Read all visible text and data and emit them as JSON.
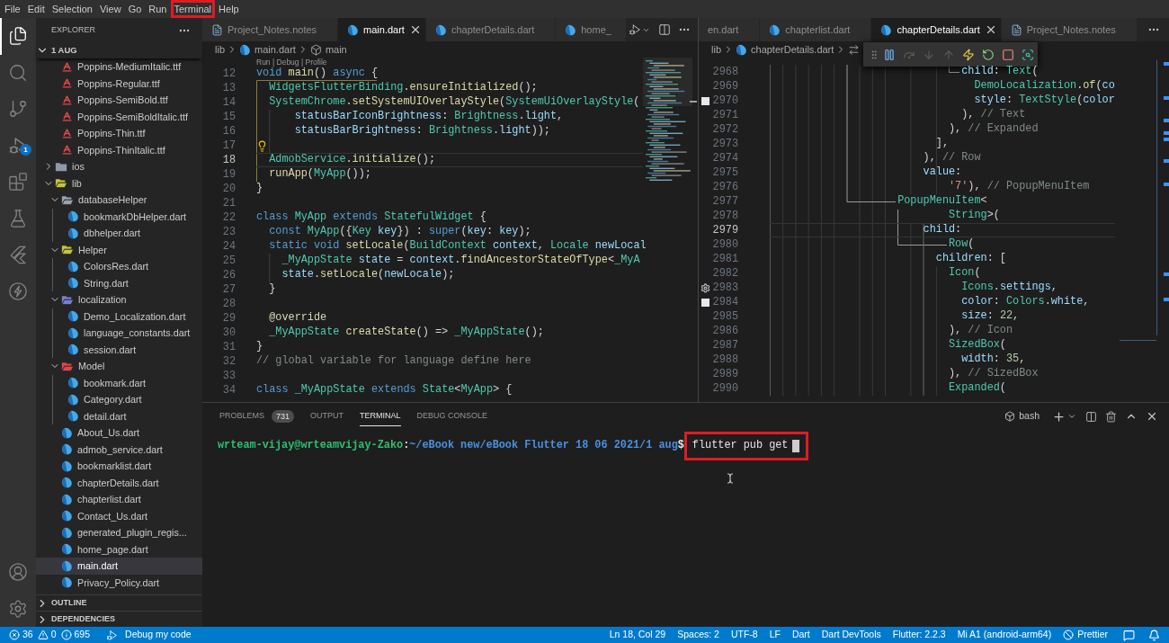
{
  "menu_bar": [
    {
      "label": "File",
      "highlighted": false
    },
    {
      "label": "Edit",
      "highlighted": false
    },
    {
      "label": "Selection",
      "highlighted": false
    },
    {
      "label": "View",
      "highlighted": false
    },
    {
      "label": "Go",
      "highlighted": false
    },
    {
      "label": "Run",
      "highlighted": false
    },
    {
      "label": "Terminal",
      "highlighted": true
    },
    {
      "label": "Help",
      "highlighted": false
    }
  ],
  "activity_bar": {
    "top": [
      {
        "kind": "explorer",
        "selected": true
      },
      {
        "kind": "search",
        "selected": false
      },
      {
        "kind": "source_control",
        "selected": false
      },
      {
        "kind": "run_debug",
        "selected": false,
        "badge": "1"
      },
      {
        "kind": "extensions",
        "selected": false
      },
      {
        "kind": "testing",
        "selected": false
      },
      {
        "kind": "flutter",
        "selected": false
      },
      {
        "kind": "lightning",
        "selected": false
      }
    ],
    "bottom": [
      {
        "kind": "accounts"
      },
      {
        "kind": "manage"
      }
    ]
  },
  "sidebar": {
    "title": "EXPLORER",
    "section": {
      "label": "1 AUG",
      "expanded": true
    },
    "tree": [
      {
        "children": [
          {
            "label": "Poppins-MediumItalic.ttf",
            "kind": "font",
            "selected": false
          },
          {
            "label": "Poppins-Regular.ttf",
            "kind": "font",
            "selected": false
          },
          {
            "label": "Poppins-SemiBold.ttf",
            "kind": "font",
            "selected": false
          },
          {
            "label": "Poppins-SemiBoldItalic.ttf",
            "kind": "font",
            "selected": false
          },
          {
            "label": "Poppins-Thin.ttf",
            "kind": "font",
            "selected": false
          },
          {
            "label": "Poppins-ThinItalic.ttf",
            "kind": "font",
            "selected": false
          }
        ]
      },
      {
        "label": "ios",
        "kind": "folder",
        "color": "#8d99a6",
        "expanded": false,
        "selected": false
      },
      {
        "label": "lib",
        "kind": "folder",
        "color": "#c5c53a",
        "expanded": true,
        "selected": false,
        "children": [
          {
            "label": "databaseHelper",
            "kind": "folder",
            "color": "#98a4b0",
            "expanded": true,
            "selected": false,
            "children": [
              {
                "label": "bookmarkDbHelper.dart",
                "kind": "dart",
                "selected": false
              },
              {
                "label": "dbhelper.dart",
                "kind": "dart",
                "selected": false
              }
            ]
          },
          {
            "label": "Helper",
            "kind": "folder",
            "color": "#c5c53a",
            "expanded": true,
            "selected": false,
            "children": [
              {
                "label": "ColorsRes.dart",
                "kind": "dart",
                "selected": false
              },
              {
                "label": "String.dart",
                "kind": "dart",
                "selected": false
              }
            ]
          },
          {
            "label": "localization",
            "kind": "folder",
            "color": "#7b7fd4",
            "expanded": true,
            "selected": false,
            "children": [
              {
                "label": "Demo_Localization.dart",
                "kind": "dart",
                "selected": false
              },
              {
                "label": "language_constants.dart",
                "kind": "dart",
                "selected": false
              },
              {
                "label": "session.dart",
                "kind": "dart",
                "selected": false
              }
            ]
          },
          {
            "label": "Model",
            "kind": "folder",
            "color": "#e0474c",
            "expanded": true,
            "selected": false,
            "children": [
              {
                "label": "bookmark.dart",
                "kind": "dart",
                "selected": false
              },
              {
                "label": "Category.dart",
                "kind": "dart",
                "selected": false
              },
              {
                "label": "detail.dart",
                "kind": "dart",
                "selected": false
              }
            ]
          },
          {
            "label": "About_Us.dart",
            "kind": "dart",
            "selected": false
          },
          {
            "label": "admob_service.dart",
            "kind": "dart",
            "selected": false
          },
          {
            "label": "bookmarklist.dart",
            "kind": "dart",
            "selected": false
          },
          {
            "label": "chapterDetails.dart",
            "kind": "dart",
            "selected": false
          },
          {
            "label": "chapterlist.dart",
            "kind": "dart",
            "selected": false
          },
          {
            "label": "Contact_Us.dart",
            "kind": "dart",
            "selected": false
          },
          {
            "label": "generated_plugin_regis...",
            "kind": "dart",
            "selected": false
          },
          {
            "label": "home_page.dart",
            "kind": "dart",
            "selected": false
          },
          {
            "label": "main.dart",
            "kind": "dart",
            "selected": true
          },
          {
            "label": "Privacy_Policy.dart",
            "kind": "dart",
            "selected": false
          }
        ]
      }
    ],
    "footer_sections": [
      {
        "label": "OUTLINE",
        "expanded": false
      },
      {
        "label": "DEPENDENCIES",
        "expanded": false
      }
    ]
  },
  "editors": {
    "left": {
      "tabs": [
        {
          "label": "Project_Notes.notes",
          "kind": "notes",
          "selected": false
        },
        {
          "label": "main.dart",
          "kind": "dart",
          "selected": true
        },
        {
          "label": "chapterDetails.dart",
          "kind": "dart",
          "selected": false
        },
        {
          "label": "home_",
          "kind": "dart",
          "selected": false
        }
      ],
      "breadcrumb": [
        {
          "text": "lib",
          "kind": "folder"
        },
        {
          "text": "main.dart",
          "kind": "dart"
        },
        {
          "text": "main",
          "kind": "symbol"
        }
      ],
      "codelens": "Run | Debug | Profile",
      "lines": [
        {
          "number": "12",
          "current": false,
          "tokens": [
            {
              "text": "void ",
              "kind": "kw"
            },
            {
              "text": "main",
              "kind": "fn"
            },
            {
              "text": "() ",
              "kind": "punct"
            },
            {
              "text": "async",
              "kind": "kw"
            },
            {
              "text": " {",
              "kind": "punct"
            }
          ]
        },
        {
          "number": "13",
          "current": false,
          "tokens": [
            {
              "text": "  WidgetsFlutterBinding",
              "kind": "type"
            },
            {
              "text": ".",
              "kind": "punct"
            },
            {
              "text": "ensureInitialized",
              "kind": "fn"
            },
            {
              "text": "();",
              "kind": "punct"
            }
          ]
        },
        {
          "number": "14",
          "current": false,
          "tokens": [
            {
              "text": "  SystemChrome",
              "kind": "type"
            },
            {
              "text": ".",
              "kind": "punct"
            },
            {
              "text": "setSystemUIOverlayStyle",
              "kind": "fn"
            },
            {
              "text": "(",
              "kind": "punct"
            },
            {
              "text": "SystemUiOverlayStyle",
              "kind": "type"
            },
            {
              "text": "(",
              "kind": "punct"
            }
          ]
        },
        {
          "number": "15",
          "current": false,
          "tokens": [
            {
              "text": "      statusBarIconBrightness",
              "kind": "var"
            },
            {
              "text": ": ",
              "kind": "punct"
            },
            {
              "text": "Brightness",
              "kind": "type"
            },
            {
              "text": ".",
              "kind": "punct"
            },
            {
              "text": "light",
              "kind": "var"
            },
            {
              "text": ",",
              "kind": "punct"
            }
          ]
        },
        {
          "number": "16",
          "current": false,
          "tokens": [
            {
              "text": "      statusBarBrightness",
              "kind": "var"
            },
            {
              "text": ": ",
              "kind": "punct"
            },
            {
              "text": "Brightness",
              "kind": "type"
            },
            {
              "text": ".",
              "kind": "punct"
            },
            {
              "text": "light",
              "kind": "var"
            },
            {
              "text": "));",
              "kind": "punct"
            }
          ]
        },
        {
          "number": "17",
          "current": false,
          "marker": {
            "kind": "lightbulb"
          }
        },
        {
          "number": "18",
          "current": true,
          "tokens": [
            {
              "text": "  AdmobService",
              "kind": "type"
            },
            {
              "text": ".",
              "kind": "punct"
            },
            {
              "text": "initialize",
              "kind": "fn"
            },
            {
              "text": "();",
              "kind": "punct"
            }
          ]
        },
        {
          "number": "19",
          "current": false,
          "tokens": [
            {
              "text": "  runApp",
              "kind": "fn"
            },
            {
              "text": "(",
              "kind": "punct"
            },
            {
              "text": "MyApp",
              "kind": "type"
            },
            {
              "text": "());",
              "kind": "punct"
            }
          ]
        },
        {
          "number": "20",
          "current": false,
          "tokens": [
            {
              "text": "}",
              "kind": "punct"
            }
          ]
        },
        {
          "number": "21",
          "current": false
        },
        {
          "number": "22",
          "current": false,
          "tokens": [
            {
              "text": "class ",
              "kind": "kw"
            },
            {
              "text": "MyApp ",
              "kind": "type"
            },
            {
              "text": "extends ",
              "kind": "kw"
            },
            {
              "text": "StatefulWidget",
              "kind": "type"
            },
            {
              "text": " {",
              "kind": "punct"
            }
          ]
        },
        {
          "number": "23",
          "current": false,
          "tokens": [
            {
              "text": "  const ",
              "kind": "kw"
            },
            {
              "text": "MyApp",
              "kind": "type"
            },
            {
              "text": "({",
              "kind": "punct"
            },
            {
              "text": "Key ",
              "kind": "type"
            },
            {
              "text": "key",
              "kind": "var"
            },
            {
              "text": "}) : ",
              "kind": "punct"
            },
            {
              "text": "super",
              "kind": "kw"
            },
            {
              "text": "(",
              "kind": "punct"
            },
            {
              "text": "key",
              "kind": "var"
            },
            {
              "text": ": ",
              "kind": "punct"
            },
            {
              "text": "key",
              "kind": "var"
            },
            {
              "text": ");",
              "kind": "punct"
            }
          ]
        },
        {
          "number": "24",
          "current": false,
          "tokens": [
            {
              "text": "  static void ",
              "kind": "kw"
            },
            {
              "text": "setLocale",
              "kind": "fn"
            },
            {
              "text": "(",
              "kind": "punct"
            },
            {
              "text": "BuildContext ",
              "kind": "type"
            },
            {
              "text": "context",
              "kind": "var"
            },
            {
              "text": ", ",
              "kind": "punct"
            },
            {
              "text": "Locale ",
              "kind": "type"
            },
            {
              "text": "newLocal",
              "kind": "var"
            }
          ]
        },
        {
          "number": "25",
          "current": false,
          "tokens": [
            {
              "text": "    _MyAppState ",
              "kind": "type"
            },
            {
              "text": "state",
              "kind": "var"
            },
            {
              "text": " = ",
              "kind": "punct"
            },
            {
              "text": "context",
              "kind": "var"
            },
            {
              "text": ".",
              "kind": "punct"
            },
            {
              "text": "findAncestorStateOfType",
              "kind": "fn"
            },
            {
              "text": "<",
              "kind": "punct"
            },
            {
              "text": "_MyA",
              "kind": "type"
            }
          ]
        },
        {
          "number": "26",
          "current": false,
          "tokens": [
            {
              "text": "    state",
              "kind": "var"
            },
            {
              "text": ".",
              "kind": "punct"
            },
            {
              "text": "setLocale",
              "kind": "fn"
            },
            {
              "text": "(",
              "kind": "punct"
            },
            {
              "text": "newLocale",
              "kind": "var"
            },
            {
              "text": ");",
              "kind": "punct"
            }
          ]
        },
        {
          "number": "27",
          "current": false,
          "tokens": [
            {
              "text": "  }",
              "kind": "punct"
            }
          ]
        },
        {
          "number": "28",
          "current": false
        },
        {
          "number": "29",
          "current": false,
          "tokens": [
            {
              "text": "  @override",
              "kind": "annotation"
            }
          ]
        },
        {
          "number": "30",
          "current": false,
          "tokens": [
            {
              "text": "  _MyAppState ",
              "kind": "type"
            },
            {
              "text": "createState",
              "kind": "fn"
            },
            {
              "text": "() => ",
              "kind": "punct"
            },
            {
              "text": "_MyAppState",
              "kind": "type"
            },
            {
              "text": "();",
              "kind": "punct"
            }
          ]
        },
        {
          "number": "31",
          "current": false,
          "tokens": [
            {
              "text": "}",
              "kind": "punct"
            }
          ]
        },
        {
          "number": "32",
          "current": false,
          "tokens": [
            {
              "text": "// global variable for language define here",
              "kind": "comment"
            }
          ]
        },
        {
          "number": "33",
          "current": false
        },
        {
          "number": "34",
          "current": false,
          "tokens": [
            {
              "text": "class ",
              "kind": "kw"
            },
            {
              "text": "_MyAppState ",
              "kind": "type"
            },
            {
              "text": "extends ",
              "kind": "kw"
            },
            {
              "text": "State",
              "kind": "type"
            },
            {
              "text": "<",
              "kind": "punct"
            },
            {
              "text": "MyApp",
              "kind": "type"
            },
            {
              "text": "> {",
              "kind": "punct"
            }
          ]
        }
      ]
    },
    "right": {
      "tabs": [
        {
          "label": "en.dart",
          "kind": "plain",
          "selected": false
        },
        {
          "label": "chapterlist.dart",
          "kind": "dart",
          "selected": false
        },
        {
          "label": "chapterDetails.dart",
          "kind": "dart",
          "selected": true
        },
        {
          "label": "Project_Notes.notes",
          "kind": "notes",
          "selected": false
        }
      ],
      "breadcrumb": [
        {
          "text": "lib",
          "kind": "folder"
        },
        {
          "text": "chapterDetails.dart",
          "kind": "dart"
        },
        {
          "kind": "method"
        }
      ],
      "debug_toolbar": [
        {
          "kind": "pause",
          "disabled": false
        },
        {
          "kind": "step_over",
          "disabled": true
        },
        {
          "kind": "step_into",
          "disabled": true
        },
        {
          "kind": "step_out",
          "disabled": true
        },
        {
          "kind": "hot_reload",
          "disabled": false
        },
        {
          "kind": "restart",
          "disabled": false
        },
        {
          "kind": "stop",
          "disabled": false
        },
        {
          "kind": "devtools",
          "disabled": false
        }
      ],
      "lines": [
        {
          "number": "2968",
          "current": false,
          "tokens": [
            {
              "text": "                              child",
              "kind": "var"
            },
            {
              "text": ": ",
              "kind": "punct"
            },
            {
              "text": "Text",
              "kind": "type"
            },
            {
              "text": "(",
              "kind": "punct"
            }
          ]
        },
        {
          "number": "2969",
          "current": false,
          "tokens": [
            {
              "text": "                                DemoLocalization",
              "kind": "type"
            },
            {
              "text": ".",
              "kind": "punct"
            },
            {
              "text": "of",
              "kind": "fn"
            },
            {
              "text": "(",
              "kind": "punct"
            },
            {
              "text": "co",
              "kind": "var"
            }
          ]
        },
        {
          "number": "2970",
          "current": false,
          "marker": {
            "kind": "swatch"
          },
          "tokens": [
            {
              "text": "                                style",
              "kind": "var"
            },
            {
              "text": ": ",
              "kind": "punct"
            },
            {
              "text": "TextStyle",
              "kind": "type"
            },
            {
              "text": "(",
              "kind": "punct"
            },
            {
              "text": "color",
              "kind": "var"
            }
          ]
        },
        {
          "number": "2971",
          "current": false,
          "tokens": [
            {
              "text": "                              ), ",
              "kind": "punct"
            },
            {
              "text": "// Text",
              "kind": "comment"
            }
          ]
        },
        {
          "number": "2972",
          "current": false,
          "tokens": [
            {
              "text": "                            ), ",
              "kind": "punct"
            },
            {
              "text": "// Expanded",
              "kind": "comment"
            }
          ]
        },
        {
          "number": "2973",
          "current": false,
          "tokens": [
            {
              "text": "                          ],",
              "kind": "punct"
            }
          ]
        },
        {
          "number": "2974",
          "current": false,
          "tokens": [
            {
              "text": "                        ), ",
              "kind": "punct"
            },
            {
              "text": "// Row",
              "kind": "comment"
            }
          ]
        },
        {
          "number": "2975",
          "current": false,
          "tokens": [
            {
              "text": "                        value",
              "kind": "var"
            },
            {
              "text": ":",
              "kind": "punct"
            }
          ]
        },
        {
          "number": "2976",
          "current": false,
          "tokens": [
            {
              "text": "                            '7'",
              "kind": "string"
            },
            {
              "text": "), ",
              "kind": "punct"
            },
            {
              "text": "// PopupMenuItem",
              "kind": "comment"
            }
          ]
        },
        {
          "number": "2977",
          "current": false,
          "tokens": [
            {
              "text": "                    PopupMenuItem",
              "kind": "type"
            },
            {
              "text": "<",
              "kind": "punct"
            }
          ]
        },
        {
          "number": "2978",
          "current": false,
          "tokens": [
            {
              "text": "                            String",
              "kind": "type"
            },
            {
              "text": ">(",
              "kind": "punct"
            }
          ]
        },
        {
          "number": "2979",
          "current": true,
          "tokens": [
            {
              "text": "                        child",
              "kind": "var"
            },
            {
              "text": ":",
              "kind": "punct"
            }
          ]
        },
        {
          "number": "2980",
          "current": false,
          "tokens": [
            {
              "text": "                            Row",
              "kind": "type"
            },
            {
              "text": "(",
              "kind": "punct"
            }
          ]
        },
        {
          "number": "2981",
          "current": false,
          "tokens": [
            {
              "text": "                          children",
              "kind": "var"
            },
            {
              "text": ": [",
              "kind": "punct"
            }
          ]
        },
        {
          "number": "2982",
          "current": false,
          "tokens": [
            {
              "text": "                            Icon",
              "kind": "type"
            },
            {
              "text": "(",
              "kind": "punct"
            }
          ]
        },
        {
          "number": "2983",
          "current": false,
          "marker": {
            "kind": "gear"
          },
          "tokens": [
            {
              "text": "                              Icons",
              "kind": "type"
            },
            {
              "text": ".",
              "kind": "punct"
            },
            {
              "text": "settings",
              "kind": "var"
            },
            {
              "text": ",",
              "kind": "punct"
            }
          ]
        },
        {
          "number": "2984",
          "current": false,
          "marker": {
            "kind": "swatch"
          },
          "tokens": [
            {
              "text": "                              color",
              "kind": "var"
            },
            {
              "text": ": ",
              "kind": "punct"
            },
            {
              "text": "Colors",
              "kind": "type"
            },
            {
              "text": ".",
              "kind": "punct"
            },
            {
              "text": "white",
              "kind": "var"
            },
            {
              "text": ",",
              "kind": "punct"
            }
          ]
        },
        {
          "number": "2985",
          "current": false,
          "tokens": [
            {
              "text": "                              size",
              "kind": "var"
            },
            {
              "text": ": ",
              "kind": "punct"
            },
            {
              "text": "22",
              "kind": "num"
            },
            {
              "text": ",",
              "kind": "punct"
            }
          ]
        },
        {
          "number": "2986",
          "current": false,
          "tokens": [
            {
              "text": "                            ), ",
              "kind": "punct"
            },
            {
              "text": "// Icon",
              "kind": "comment"
            }
          ]
        },
        {
          "number": "2987",
          "current": false,
          "tokens": [
            {
              "text": "                            SizedBox",
              "kind": "type"
            },
            {
              "text": "(",
              "kind": "punct"
            }
          ]
        },
        {
          "number": "2988",
          "current": false,
          "tokens": [
            {
              "text": "                              width",
              "kind": "var"
            },
            {
              "text": ": ",
              "kind": "punct"
            },
            {
              "text": "35",
              "kind": "num"
            },
            {
              "text": ",",
              "kind": "punct"
            }
          ]
        },
        {
          "number": "2989",
          "current": false,
          "tokens": [
            {
              "text": "                            ), ",
              "kind": "punct"
            },
            {
              "text": "// SizedBox",
              "kind": "comment"
            }
          ]
        },
        {
          "number": "2990",
          "current": false,
          "tokens": [
            {
              "text": "                            Expanded",
              "kind": "type"
            },
            {
              "text": "(",
              "kind": "punct"
            }
          ]
        }
      ]
    }
  },
  "panel": {
    "tabs": [
      {
        "label": "PROBLEMS",
        "badge": "731",
        "selected": false
      },
      {
        "label": "OUTPUT",
        "selected": false
      },
      {
        "label": "TERMINAL",
        "selected": true
      },
      {
        "label": "DEBUG CONSOLE",
        "selected": false
      }
    ],
    "terminal_name": "bash"
  },
  "terminal": {
    "user_host": "wrteam-vijay@wrteamvijay-Zako",
    "separator": ":",
    "path": "~/eBook new/eBook Flutter 18 06 2021/1 aug",
    "prompt_symbol": "$",
    "command": "flutter pub get",
    "highlighted": true
  },
  "status_bar": {
    "errors": "36",
    "warnings": "0",
    "infos": "695",
    "debug_target": "Debug my code",
    "items": [
      {
        "kind": "text",
        "text": "Ln 18, Col 29"
      },
      {
        "kind": "text",
        "text": "Spaces: 2"
      },
      {
        "kind": "text",
        "text": "UTF-8"
      },
      {
        "kind": "text",
        "text": "LF"
      },
      {
        "kind": "text",
        "text": "Dart"
      },
      {
        "kind": "text",
        "text": "Dart DevTools"
      },
      {
        "kind": "text",
        "text": "Flutter: 2.2.3"
      },
      {
        "kind": "text",
        "text": "Mi A1 (android-arm64)"
      },
      {
        "kind": "prettier",
        "text": "Prettier"
      }
    ]
  }
}
